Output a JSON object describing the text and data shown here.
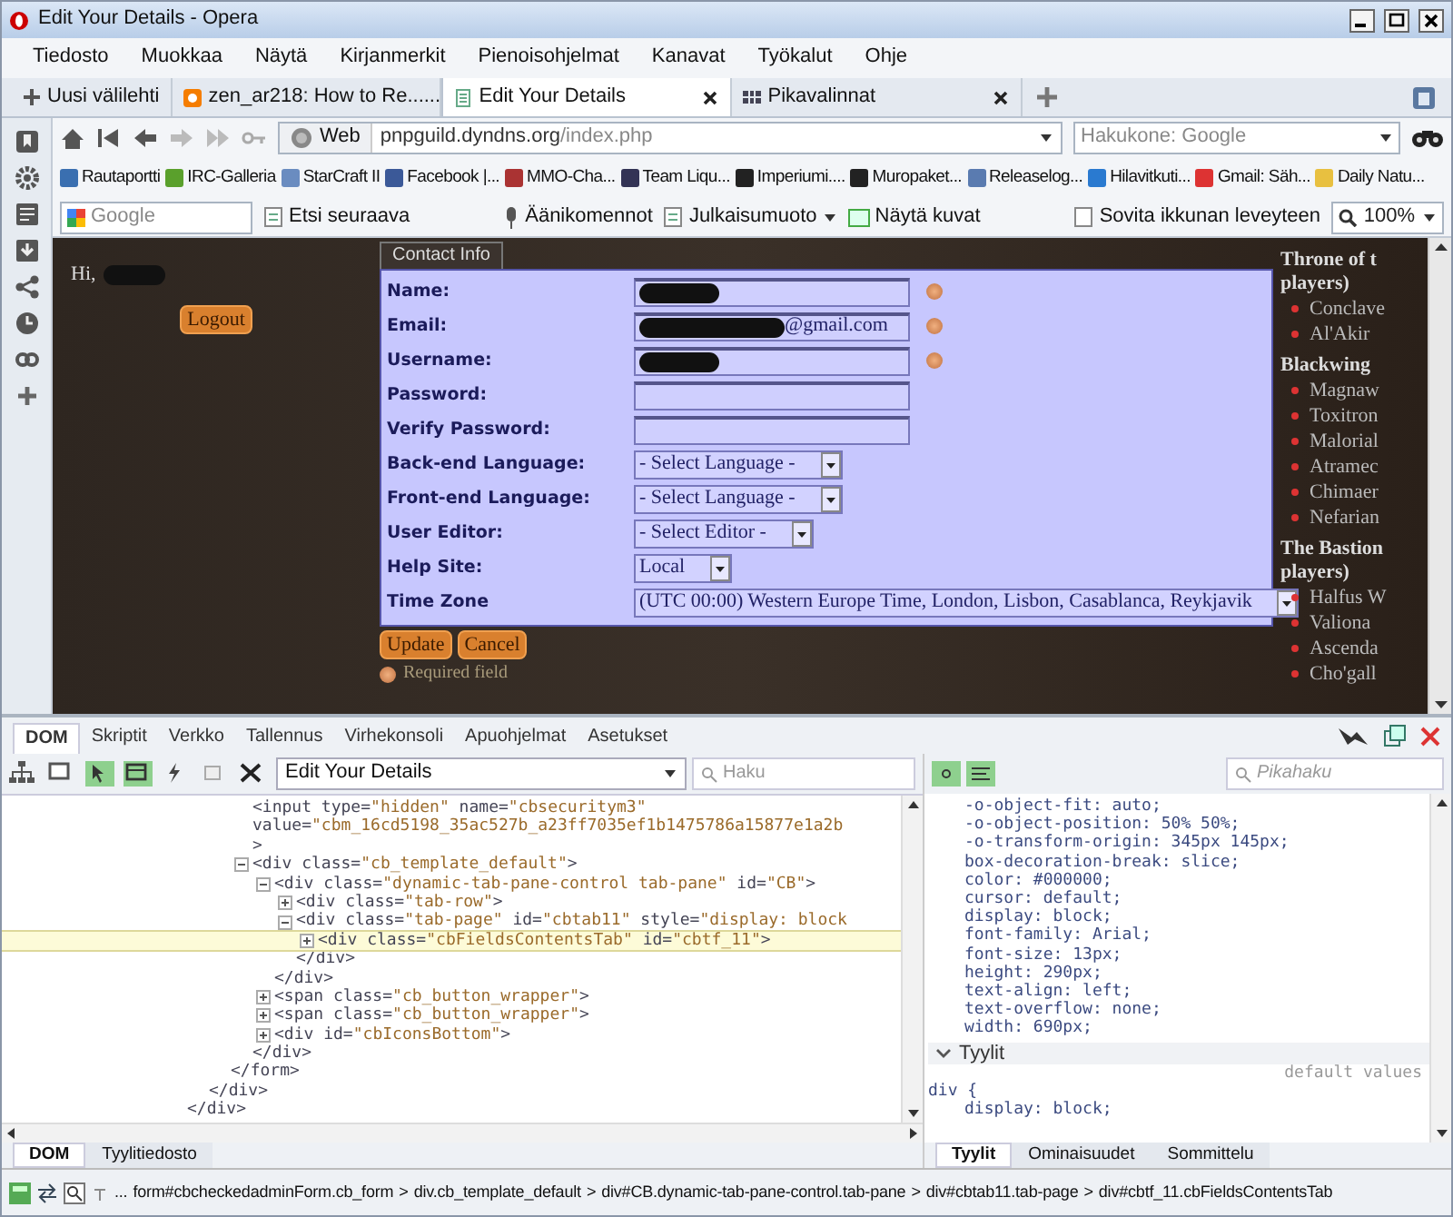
{
  "window": {
    "title": "Edit Your Details - Opera"
  },
  "menu": [
    "Tiedosto",
    "Muokkaa",
    "Näytä",
    "Kirjanmerkit",
    "Pienoisohjelmat",
    "Kanavat",
    "Työkalut",
    "Ohje"
  ],
  "new_tab": "Uusi välilehti",
  "tabs": [
    {
      "label": "zen_ar218: How to Re......",
      "selected": false
    },
    {
      "label": "Edit Your Details",
      "selected": true
    },
    {
      "label": "Pikavalinnat",
      "selected": false
    }
  ],
  "address_bar": {
    "engine": "Web",
    "host": "pnpguild.dyndns.org",
    "path": "/index.php"
  },
  "search": {
    "placeholder": "Hakukone: Google"
  },
  "bookmarks": [
    "Rautaportti",
    "IRC-Galleria",
    "StarCraft II",
    "Facebook |...",
    "MMO-Cha...",
    "Team Liqu...",
    "Imperiumi....",
    "Muropaket...",
    "Releaselog...",
    "Hilavitkuti...",
    "Gmail: Säh...",
    "Daily Natu..."
  ],
  "find_bar": {
    "placeholder": "Google",
    "find_next": "Etsi seuraava",
    "voice": "Äänikomennot",
    "style": "Julkaisumuoto",
    "images": "Näytä kuvat",
    "fit": "Sovita ikkunan leveyteen",
    "zoom": "100%"
  },
  "page": {
    "greeting": "Hi,",
    "greeting_redacted": true,
    "logout": "Logout",
    "form_tab": "Contact Info",
    "fields": [
      {
        "label": "Name:",
        "kind": "text",
        "redacted": true,
        "required": true
      },
      {
        "label": "Email:",
        "kind": "text",
        "value": "@gmail.com",
        "redacted": true,
        "required": true
      },
      {
        "label": "Username:",
        "kind": "text",
        "redacted": true,
        "required": true
      },
      {
        "label": "Password:",
        "kind": "text",
        "redacted": false,
        "required": false
      },
      {
        "label": "Verify Password:",
        "kind": "text",
        "redacted": false,
        "required": false
      },
      {
        "label": "Back-end Language:",
        "kind": "select",
        "value": "- Select Language -"
      },
      {
        "label": "Front-end Language:",
        "kind": "select",
        "value": "- Select Language -"
      },
      {
        "label": "User Editor:",
        "kind": "select",
        "value": "- Select Editor -"
      },
      {
        "label": "Help Site:",
        "kind": "select",
        "value": "Local"
      },
      {
        "label": "Time Zone",
        "kind": "select",
        "value": "(UTC 00:00) Western Europe Time, London, Lisbon, Casablanca, Reykjavik"
      }
    ],
    "buttons": [
      "Update",
      "Cancel"
    ],
    "required_note": "Required field",
    "side_sections": [
      {
        "heading_lines": [
          "Throne of t",
          "players)"
        ],
        "items": [
          "Conclave",
          "Al'Akir"
        ]
      },
      {
        "heading_lines": [
          "Blackwing"
        ],
        "items": [
          "Magnaw",
          "Toxitron",
          "Malorial",
          "Atramec",
          "Chimaer",
          "Nefarian"
        ]
      },
      {
        "heading_lines": [
          "The Bastion",
          "players)"
        ],
        "items": [
          "Halfus W",
          "Valiona",
          "Ascenda",
          "Cho'gall"
        ]
      }
    ]
  },
  "devtools": {
    "tabs": [
      {
        "label": "DOM",
        "selected": true
      },
      {
        "label": "Skriptit",
        "selected": false
      },
      {
        "label": "Verkko",
        "selected": false
      },
      {
        "label": "Tallennus",
        "selected": false
      },
      {
        "label": "Virhekonsoli",
        "selected": false
      },
      {
        "label": "Apuohjelmat",
        "selected": false
      },
      {
        "label": "Asetukset",
        "selected": false
      }
    ],
    "document_select": "Edit Your Details",
    "search_placeholder": "Haku",
    "dom_tree": [
      {
        "close": "</div>",
        "children": [
          {
            "close": "</div>",
            "children": [
              {
                "close": "</form>",
                "children": [
                  {
                    "text": "<input type=\"hidden\" name=\"cbsecuritym3\"",
                    "more": [
                      "value=\"cbm_16cd5198_35ac527b_a23ff7035ef1b1475786a15877e1a2b",
                      ">"
                    ]
                  },
                  {
                    "text": "<div class=\"cb_template_default\">",
                    "expanded": true,
                    "close": "</div>",
                    "children": [
                      {
                        "text": "<div class=\"dynamic-tab-pane-control tab-pane\" id=\"CB\">",
                        "expanded": true,
                        "close": "</div>",
                        "children": [
                          {
                            "text": "<div class=\"tab-row\">",
                            "expanded": false
                          },
                          {
                            "text": "<div class=\"tab-page\" id=\"cbtab11\" style=\"display: block",
                            "expanded": true,
                            "close": "</div>",
                            "children": [
                              {
                                "text": "<div class=\"cbFieldsContentsTab\" id=\"cbtf_11\">",
                                "expanded": false,
                                "selected": true
                              }
                            ]
                          }
                        ]
                      },
                      {
                        "text": "<span class=\"cb_button_wrapper\">",
                        "expanded": false
                      },
                      {
                        "text": "<span class=\"cb_button_wrapper\">",
                        "expanded": false
                      },
                      {
                        "text": "<div id=\"cbIconsBottom\">",
                        "expanded": false
                      }
                    ]
                  }
                ]
              }
            ]
          }
        ]
      }
    ],
    "styles_search_placeholder": "Pikahaku",
    "computed": [
      "-o-object-fit: auto;",
      "-o-object-position: 50% 50%;",
      "-o-transform-origin: 345px 145px;",
      "box-decoration-break: slice;",
      "color: #000000;",
      "cursor: default;",
      "display: block;",
      "font-family: Arial;",
      "font-size: 13px;",
      "height: 290px;",
      "text-align: left;",
      "text-overflow: none;",
      "width: 690px;"
    ],
    "styles_section": "Tyylit",
    "styles_note": "default values",
    "style_rules": [
      "div {",
      "display: block;"
    ],
    "left_tabs": [
      {
        "label": "DOM",
        "selected": true
      },
      {
        "label": "Tyylitiedosto",
        "selected": false
      }
    ],
    "right_tabs": [
      {
        "label": "Tyylit",
        "selected": true
      },
      {
        "label": "Ominaisuudet",
        "selected": false
      },
      {
        "label": "Sommittelu",
        "selected": false
      }
    ]
  },
  "status_bar": {
    "ellipsis": "...",
    "separator": ">",
    "path": [
      "form#cbcheckedadminForm.cb_form",
      "div.cb_template_default",
      "div#CB.dynamic-tab-pane-control.tab-pane",
      "div#cbtab11.tab-page",
      "div#cbtf_11.cbFieldsContentsTab"
    ]
  }
}
